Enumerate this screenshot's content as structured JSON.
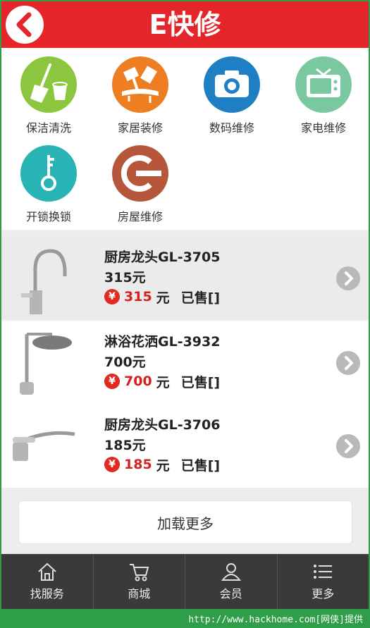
{
  "header": {
    "title": "E快修",
    "back_icon": "chevron-left-icon",
    "color": "#e4262b"
  },
  "categories": [
    {
      "label": "保洁清洗",
      "icon": "broom-bucket-icon",
      "color": "#8cc63f"
    },
    {
      "label": "家居装修",
      "icon": "paint-tools-icon",
      "color": "#ef7d21"
    },
    {
      "label": "数码维修",
      "icon": "camera-icon",
      "color": "#1f7fc4"
    },
    {
      "label": "家电维修",
      "icon": "tv-icon",
      "color": "#79c8a0"
    },
    {
      "label": "开锁换锁",
      "icon": "key-icon",
      "color": "#28b3b4"
    },
    {
      "label": "房屋维修",
      "icon": "plug-icon",
      "color": "#b6573b"
    }
  ],
  "products": [
    {
      "name": "厨房龙头GL-3705",
      "price_text": "315元",
      "price_red": "315",
      "unit": "元",
      "sold": "已售[]",
      "currency_icon": "¥",
      "thumb": "kitchen-faucet-icon"
    },
    {
      "name": "淋浴花洒GL-3932",
      "price_text": "700元",
      "price_red": "700",
      "unit": "元",
      "sold": "已售[]",
      "currency_icon": "¥",
      "thumb": "shower-head-icon"
    },
    {
      "name": "厨房龙头GL-3706",
      "price_text": "185元",
      "price_red": "185",
      "unit": "元",
      "sold": "已售[]",
      "currency_icon": "¥",
      "thumb": "kitchen-faucet-icon"
    }
  ],
  "load_more": "加载更多",
  "tabs": [
    {
      "label": "找服务",
      "icon": "home-icon"
    },
    {
      "label": "商城",
      "icon": "cart-icon"
    },
    {
      "label": "会员",
      "icon": "user-icon"
    },
    {
      "label": "更多",
      "icon": "list-icon"
    }
  ],
  "watermark": "http://www.hackhome.com[网侠]提供"
}
